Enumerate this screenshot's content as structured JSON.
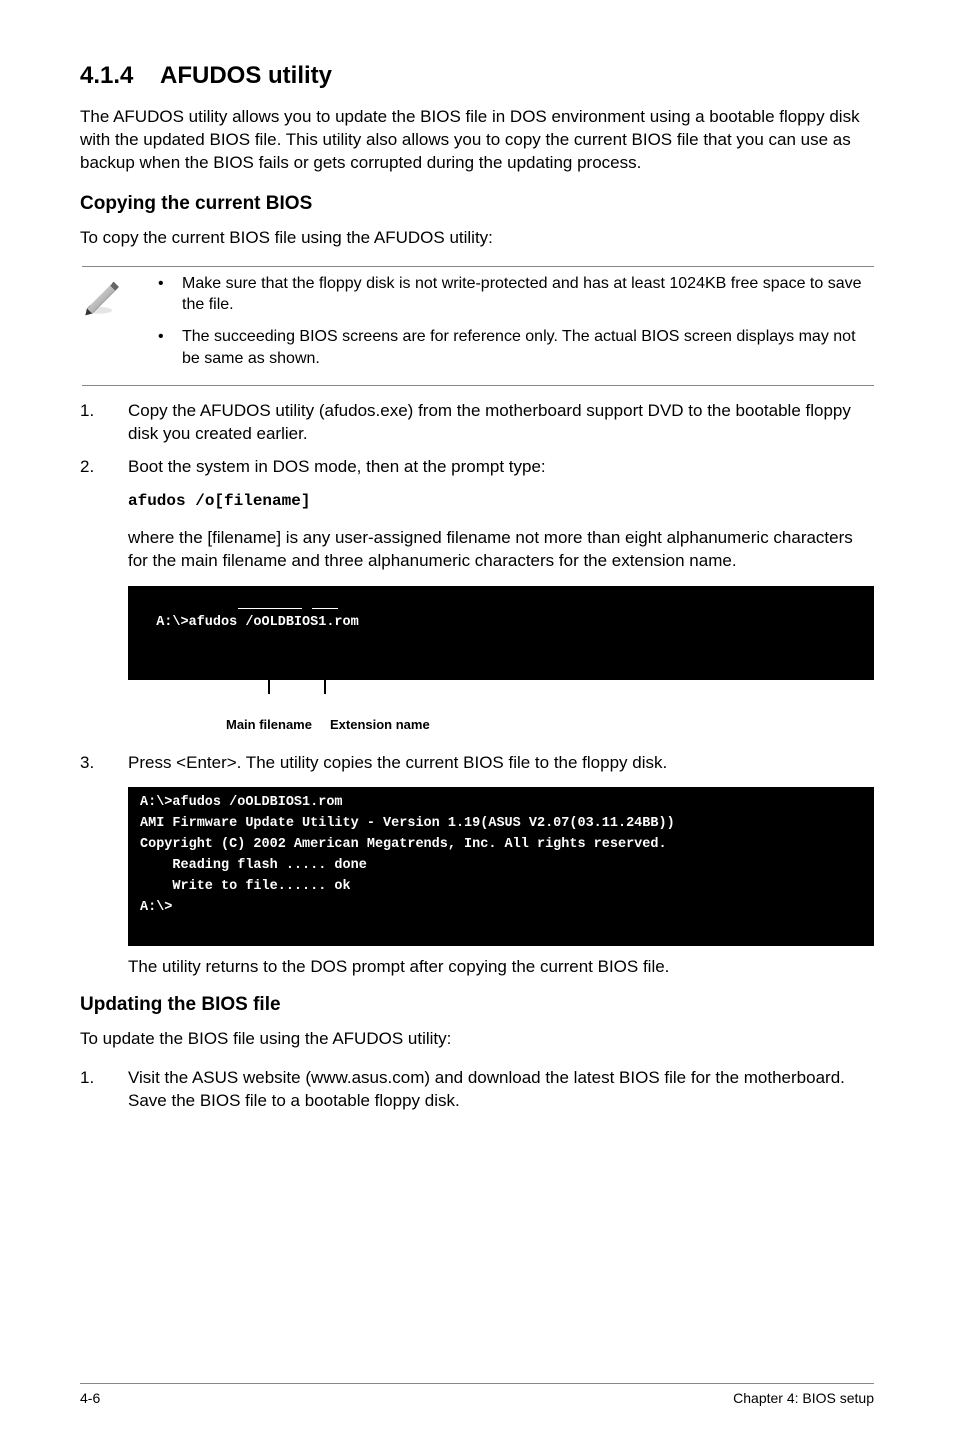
{
  "heading": {
    "number": "4.1.4",
    "title": "AFUDOS utility"
  },
  "intro": "The AFUDOS utility allows you to update the BIOS file in DOS environment using a bootable floppy disk with the updated BIOS file. This utility also allows you to copy the current BIOS file that you can use as backup when the BIOS fails or gets corrupted during the updating process.",
  "copy_heading": "Copying the current BIOS",
  "copy_intro": "To copy the current BIOS file using the AFUDOS utility:",
  "notes": [
    "Make sure that the floppy disk is not write-protected and has at least 1024KB free space to save the file.",
    "The succeeding BIOS screens are for reference only. The actual BIOS screen displays may not be same as shown."
  ],
  "step1": {
    "num": "1.",
    "text": "Copy the AFUDOS utility (afudos.exe) from the motherboard support DVD to the bootable floppy disk you created earlier."
  },
  "step2": {
    "num": "2.",
    "text": "Boot the system in DOS mode, then at the prompt type:"
  },
  "code1": "afudos /o[filename]",
  "where": "where the [filename] is any user-assigned filename not more than eight alphanumeric characters  for the main filename and three alphanumeric characters for the extension name.",
  "terminal1": "A:\\>afudos /oOLDBIOS1.rom",
  "labels": {
    "main": "Main filename",
    "ext": "Extension name"
  },
  "step3": {
    "num": "3.",
    "text": "Press <Enter>. The utility copies the current BIOS file to the floppy disk."
  },
  "terminal2": "A:\\>afudos /oOLDBIOS1.rom\nAMI Firmware Update Utility - Version 1.19(ASUS V2.07(03.11.24BB))\nCopyright (C) 2002 American Megatrends, Inc. All rights reserved.\n    Reading flash ..... done\n    Write to file...... ok\nA:\\>\n ",
  "after_terminal": "The utility returns to the DOS prompt after copying the current BIOS file.",
  "update_heading": "Updating the BIOS file",
  "update_intro": "To update the BIOS file using the AFUDOS utility:",
  "update_step1": {
    "num": "1.",
    "text": "Visit the ASUS website (www.asus.com) and download the latest BIOS file for the motherboard. Save the BIOS file to a bootable floppy disk."
  },
  "footer": {
    "left": "4-6",
    "right": "Chapter 4: BIOS setup"
  }
}
